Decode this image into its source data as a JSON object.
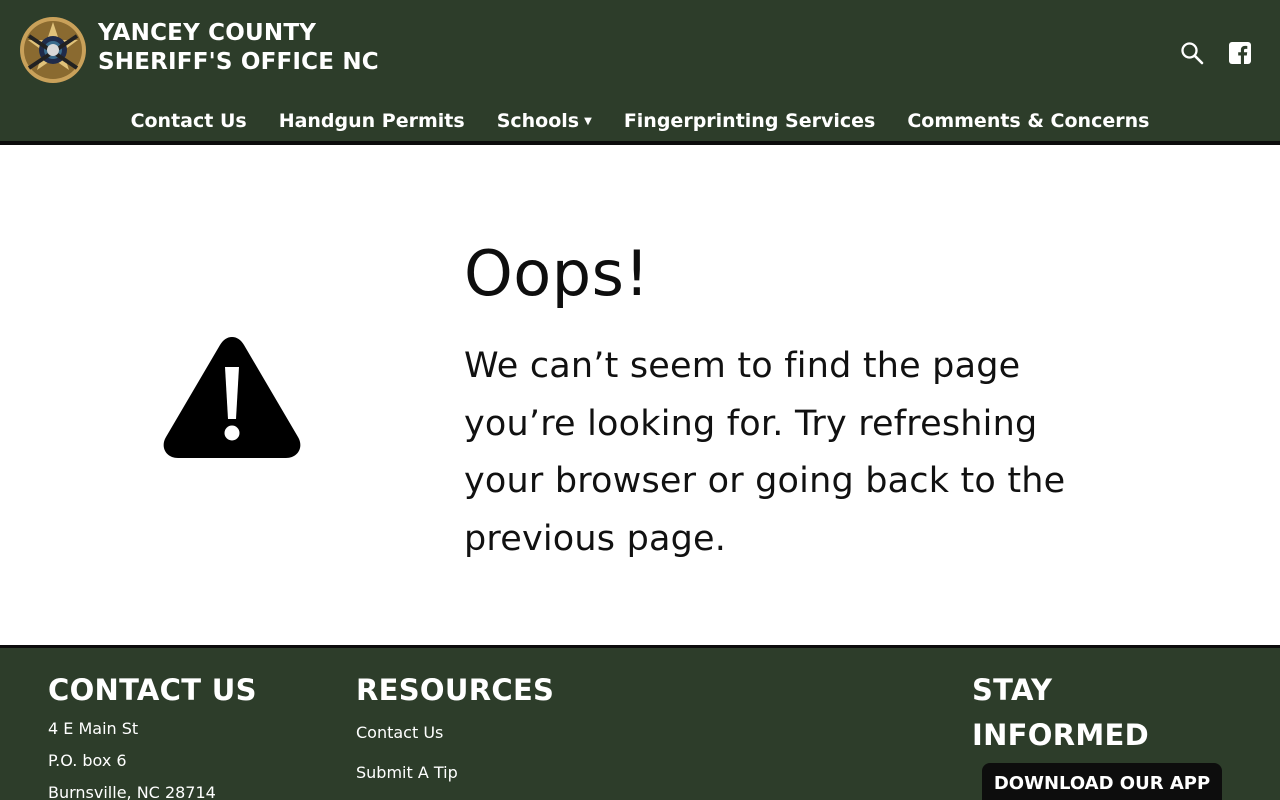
{
  "colors": {
    "brand": "#2d3d2a",
    "divider": "#0c0c0c",
    "button": "#0d0d0d"
  },
  "header": {
    "title_line1": "YANCEY COUNTY",
    "title_line2": "SHERIFF'S OFFICE NC",
    "logo": "sheriff-star-badge",
    "icons": [
      "search-icon",
      "facebook-icon"
    ]
  },
  "nav": {
    "items": [
      {
        "label": "Contact Us"
      },
      {
        "label": "Handgun Permits"
      },
      {
        "label": "Schools"
      },
      {
        "label": "Fingerprinting Services"
      },
      {
        "label": "Comments & Concerns"
      }
    ]
  },
  "error": {
    "icon": "warning-icon",
    "title": "Oops!",
    "line1": "We can’t seem to find the page",
    "line2": "you’re looking for. Try refreshing",
    "line3": "your browser or going back to the",
    "line4": "previous page."
  },
  "footer": {
    "contact": {
      "heading": "CONTACT US",
      "lines": [
        "4 E Main St",
        "P.O. box 6",
        "Burnsville, NC 28714"
      ]
    },
    "resources": {
      "heading": "RESOURCES",
      "links": [
        "Contact Us",
        "Submit A Tip"
      ]
    },
    "stay": {
      "heading": "STAY INFORMED",
      "app_button": "DOWNLOAD OUR APP"
    }
  }
}
